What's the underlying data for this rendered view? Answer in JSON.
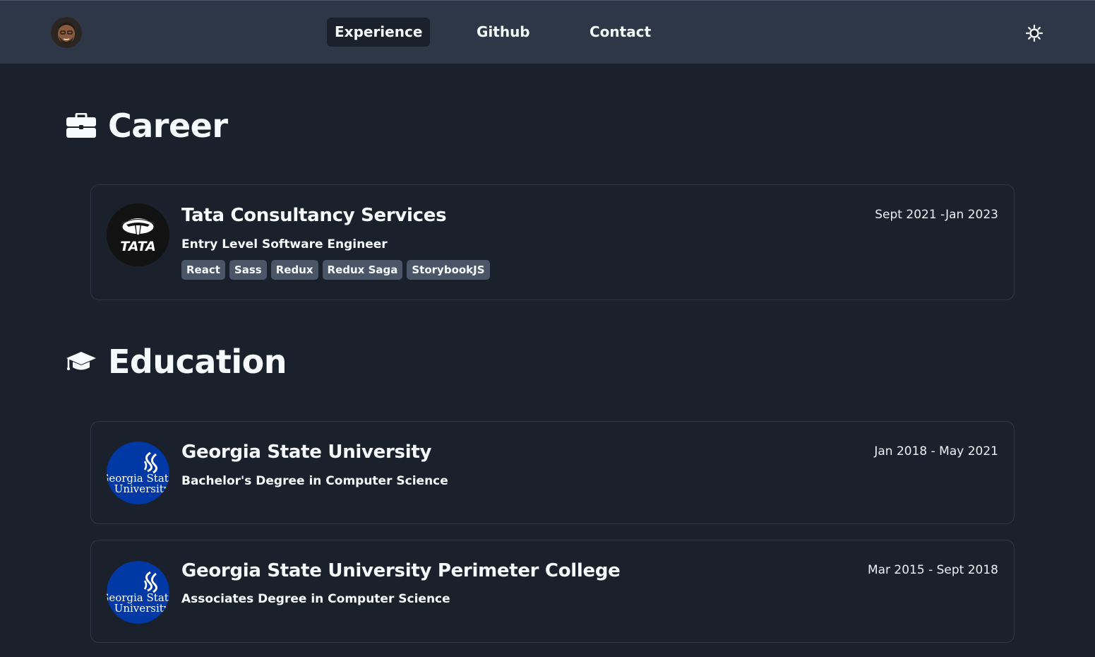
{
  "nav": {
    "links": [
      {
        "label": "Experience",
        "active": true
      },
      {
        "label": "Github",
        "active": false
      },
      {
        "label": "Contact",
        "active": false
      }
    ],
    "avatar_icon": "memoji-avatar-icon",
    "theme_icon": "sun-icon"
  },
  "career": {
    "title": "Career",
    "icon": "briefcase-icon",
    "items": [
      {
        "company": "Tata Consultancy Services",
        "role": "Entry Level Software Engineer",
        "dates": "Sept 2021 -Jan 2023",
        "logo_text": "TATA",
        "tags": [
          "React",
          "Sass",
          "Redux",
          "Redux Saga",
          "StorybookJS"
        ]
      }
    ]
  },
  "education": {
    "title": "Education",
    "icon": "graduation-cap-icon",
    "items": [
      {
        "school": "Georgia State University",
        "degree": "Bachelor's Degree in Computer Science",
        "dates": "Jan 2018 - May 2021",
        "logo_text": [
          "Georgia State",
          "University"
        ]
      },
      {
        "school": "Georgia State University Perimeter College",
        "degree": "Associates Degree in Computer Science",
        "dates": "Mar 2015 - Sept 2018",
        "logo_text": [
          "Georgia State",
          "University"
        ]
      }
    ]
  },
  "colors": {
    "background": "#1a202c",
    "navbar": "#2d3748",
    "tag": "#4a5568",
    "gsu_blue": "#0039a6"
  }
}
